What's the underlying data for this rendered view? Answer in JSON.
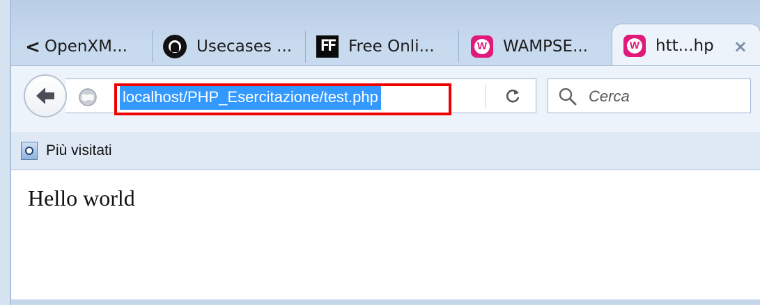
{
  "tabs": [
    {
      "label": "OpenXM...",
      "icon": "none"
    },
    {
      "label": "Usecases ...",
      "icon": "github-icon"
    },
    {
      "label": "Free Onli...",
      "icon": "ff-icon"
    },
    {
      "label": "WAMPSE...",
      "icon": "wampserver-icon"
    },
    {
      "label": "htt...hp",
      "icon": "wampserver-icon",
      "active": true
    }
  ],
  "tab_icons": {
    "ff": "FF",
    "wamp": "W"
  },
  "tab_close": "×",
  "tab_scroll": "<",
  "address": {
    "url": "localhost/PHP_Esercitazione/test.php"
  },
  "search": {
    "placeholder": "Cerca"
  },
  "bookmarks": {
    "most_visited": "Più visitati"
  },
  "page": {
    "body_text": "Hello world"
  },
  "colors": {
    "selection": "#3399ff",
    "highlight_box": "#ee0000",
    "wamp_pink": "#e0197b"
  }
}
